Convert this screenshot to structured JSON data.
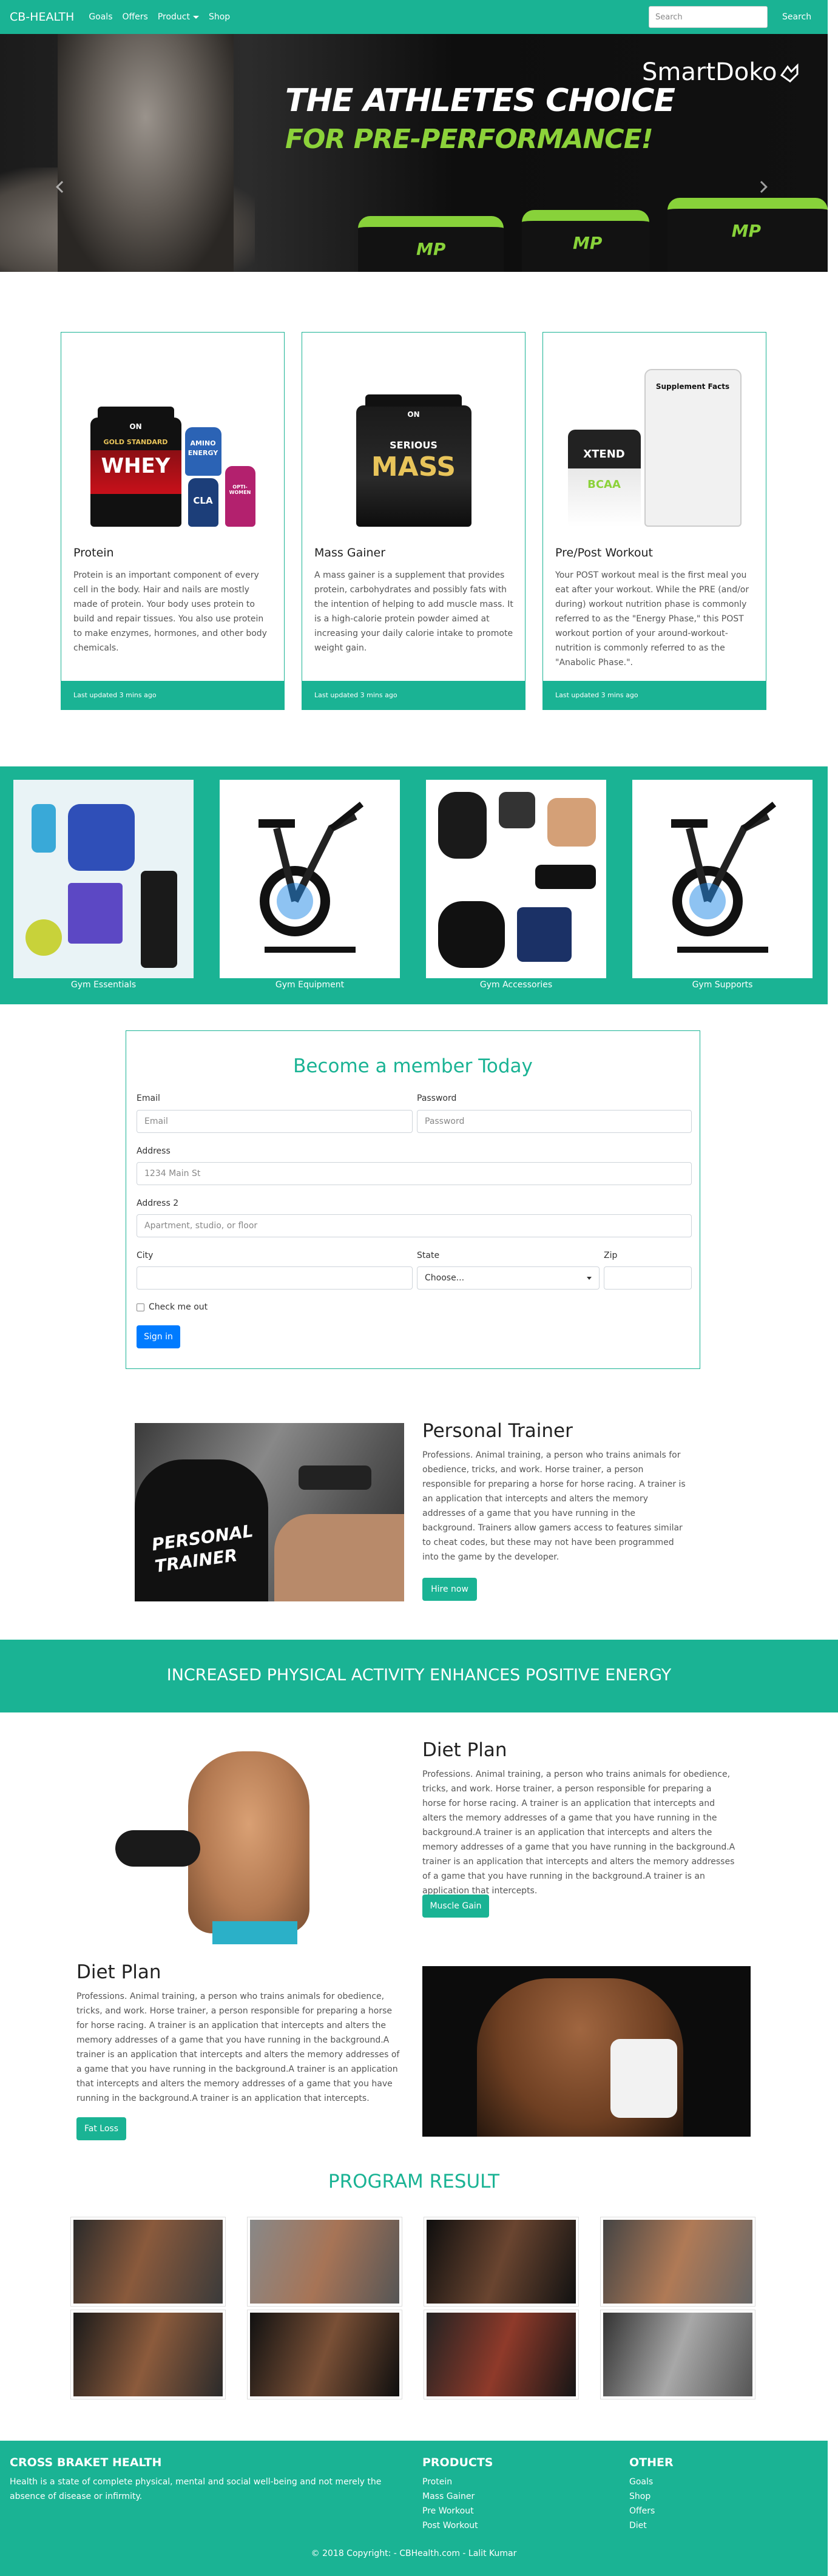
{
  "navbar": {
    "brand": "CB-HEALTH",
    "links": [
      "Goals",
      "Offers",
      "Product",
      "Shop"
    ],
    "search_placeholder": "Search",
    "search_button": "Search"
  },
  "hero": {
    "headline": "THE ATHLETES CHOICE",
    "subheadline": "FOR PRE-PERFORMANCE!",
    "logo_text": "SmartDoko",
    "tub_mark": "MP"
  },
  "products": [
    {
      "title": "Protein",
      "text": "Protein is an important component of every cell in the body. Hair and nails are mostly made of protein. Your body uses protein to build and repair tissues. You also use protein to make enzymes, hormones, and other body chemicals.",
      "footer": "Last updated 3 mins ago",
      "labels": [
        "WHEY",
        "GOLD STANDARD",
        "ON",
        "AMINO",
        "ENERGY",
        "CLA",
        "OPTI-WOMEN"
      ]
    },
    {
      "title": "Mass Gainer",
      "text": "A mass gainer is a supplement that provides protein, carbohydrates and possibly fats with the intention of helping to add muscle mass. It is a high-calorie protein powder aimed at increasing your daily calorie intake to promote weight gain.",
      "footer": "Last updated 3 mins ago",
      "labels": [
        "SERIOUS",
        "MASS",
        "ON"
      ]
    },
    {
      "title": "Pre/Post Workout",
      "text": "Your POST workout meal is the first meal you eat after your workout. While the PRE (and/or during) workout nutrition phase is commonly referred to as the \"Energy Phase,\" this POST workout portion of your around-workout-nutrition is commonly referred to as the \"Anabolic Phase.\".",
      "footer": "Last updated 3 mins ago",
      "labels": [
        "XTEND",
        "BCAA",
        "Supplement Facts"
      ]
    }
  ],
  "categories": [
    "Gym Essentials",
    "Gym Equipment",
    "Gym Accessories",
    "Gym Supports"
  ],
  "form": {
    "title": "Become a member Today",
    "email_label": "Email",
    "email_placeholder": "Email",
    "password_label": "Password",
    "password_placeholder": "Password",
    "address_label": "Address",
    "address_placeholder": "1234 Main St",
    "address2_label": "Address 2",
    "address2_placeholder": "Apartment, studio, or floor",
    "city_label": "City",
    "state_label": "State",
    "state_value": "Choose...",
    "zip_label": "Zip",
    "check_label": "Check me out",
    "submit": "Sign in"
  },
  "trainer": {
    "title": "Personal Trainer",
    "shirt_text": "PERSONAL TRAINER",
    "text": "Professions. Animal training, a person who trains animals for obedience, tricks, and work. Horse trainer, a person responsible for preparing a horse for horse racing. A trainer is an application that intercepts and alters the memory addresses of a game that you have running in the background. Trainers allow gamers access to features similar to cheat codes, but these may not have been programmed into the game by the developer.",
    "button": "Hire now"
  },
  "banner": "INCREASED PHYSICAL ACTIVITY ENHANCES POSITIVE ENERGY",
  "diet1": {
    "title": "Diet Plan",
    "text": "Professions. Animal training, a person who trains animals for obedience, tricks, and work. Horse trainer, a person responsible for preparing a horse for horse racing. A trainer is an application that intercepts and alters the memory addresses of a game that you have running in the background.A trainer is an application that intercepts and alters the memory addresses of a game that you have running in the background.A trainer is an application that intercepts and alters the memory addresses of a game that you have running in the background.A trainer is an application that intercepts.",
    "button": "Muscle Gain"
  },
  "diet2": {
    "title": "Diet Plan",
    "text": "Professions. Animal training, a person who trains animals for obedience, tricks, and work. Horse trainer, a person responsible for preparing a horse for horse racing. A trainer is an application that intercepts and alters the memory addresses of a game that you have running in the background.A trainer is an application that intercepts and alters the memory addresses of a game that you have running in the background.A trainer is an application that intercepts and alters the memory addresses of a game that you have running in the background.A trainer is an application that intercepts.",
    "button": "Fat Loss"
  },
  "program": {
    "title": "PROGRAM RESULT"
  },
  "footer": {
    "brand": "CROSS BRAKET HEALTH",
    "about": "Health is a state of complete physical, mental and social well-being and not merely the absence of disease or infirmity.",
    "products_title": "PRODUCTS",
    "products": [
      "Protein",
      "Mass Gainer",
      "Pre Workout",
      "Post Workout"
    ],
    "other_title": "OTHER",
    "other": [
      "Goals",
      "Shop",
      "Offers",
      "Diet"
    ],
    "copyright": "© 2018 Copyright: - CBHealth.com - Lalit Kumar"
  }
}
